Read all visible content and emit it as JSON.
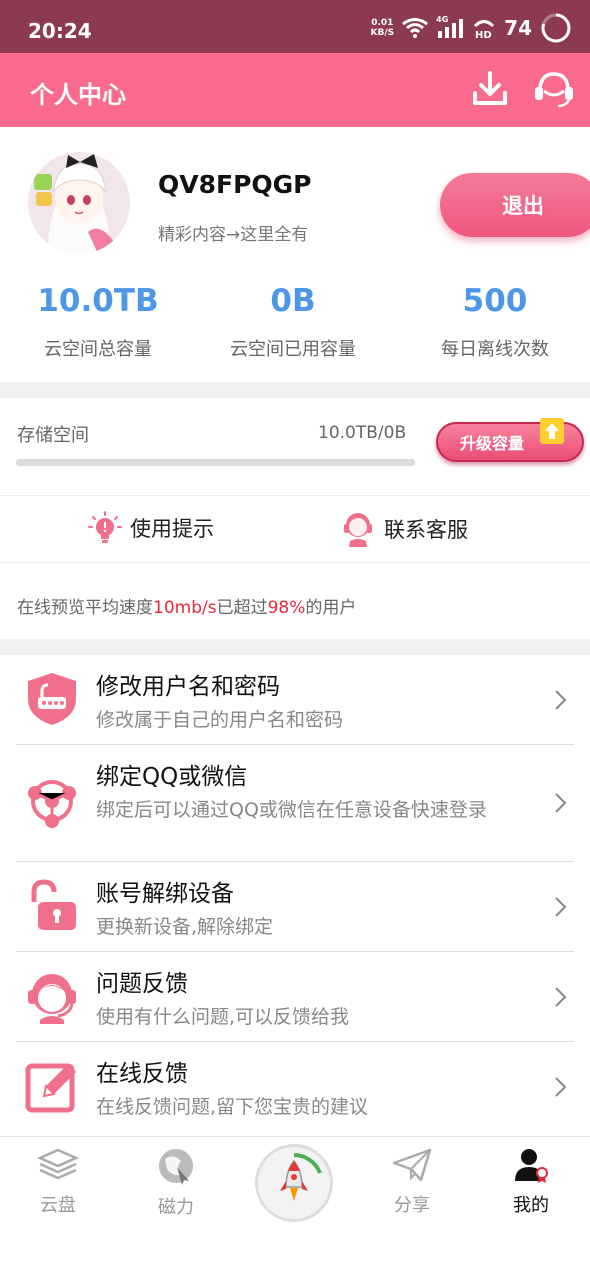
{
  "status_bar": {
    "time": "20:24",
    "net_speed_value": "0.01",
    "net_speed_unit": "KB/S",
    "network": "4G",
    "battery": "74"
  },
  "header": {
    "title": "个人中心",
    "download_icon": "download-icon",
    "support_icon": "headset-icon"
  },
  "profile": {
    "username": "QV8FPQGP",
    "slogan": "精彩内容→这里全有",
    "logout_label": "退出",
    "stats": [
      {
        "value": "10.0TB",
        "label": "云空间总容量"
      },
      {
        "value": "0B",
        "label": "云空间已用容量"
      },
      {
        "value": "500",
        "label": "每日离线次数"
      }
    ]
  },
  "storage": {
    "label": "存储空间",
    "value": "10.0TB/0B",
    "used_fraction": 0,
    "upgrade_label": "升级容量"
  },
  "quick_actions": [
    {
      "label": "使用提示",
      "icon": "lightbulb-icon"
    },
    {
      "label": "联系客服",
      "icon": "customer-service-icon"
    }
  ],
  "speed_info": {
    "prefix": "在线预览平均速度",
    "speed": "10mb/s",
    "middle": "已超过",
    "percent": "98%",
    "suffix": "的用户"
  },
  "menu": [
    {
      "title": "修改用户名和密码",
      "desc": "修改属于自己的用户名和密码",
      "icon": "shield-password-icon"
    },
    {
      "title": "绑定QQ或微信",
      "desc": "绑定后可以通过QQ或微信在任意设备快速登录",
      "icon": "share-network-icon"
    },
    {
      "title": "账号解绑设备",
      "desc": "更换新设备,解除绑定",
      "icon": "unlock-icon"
    },
    {
      "title": "问题反馈",
      "desc": "使用有什么问题,可以反馈给我",
      "icon": "headset-feedback-icon"
    },
    {
      "title": "在线反馈",
      "desc": "在线反馈问题,留下您宝贵的建议",
      "icon": "edit-icon"
    }
  ],
  "tabbar": [
    {
      "label": "云盘",
      "icon": "layers-icon",
      "active": false
    },
    {
      "label": "磁力",
      "icon": "magnet-icon",
      "active": false
    },
    {
      "label": "",
      "icon": "rocket-icon",
      "active": false
    },
    {
      "label": "分享",
      "icon": "paper-plane-icon",
      "active": false
    },
    {
      "label": "我的",
      "icon": "user-icon",
      "active": true
    }
  ],
  "colors": {
    "accent": "#f96a8c",
    "status_bar": "#8c3a50",
    "stat_blue": "#4d97e6",
    "highlight_red": "#e8283c"
  }
}
